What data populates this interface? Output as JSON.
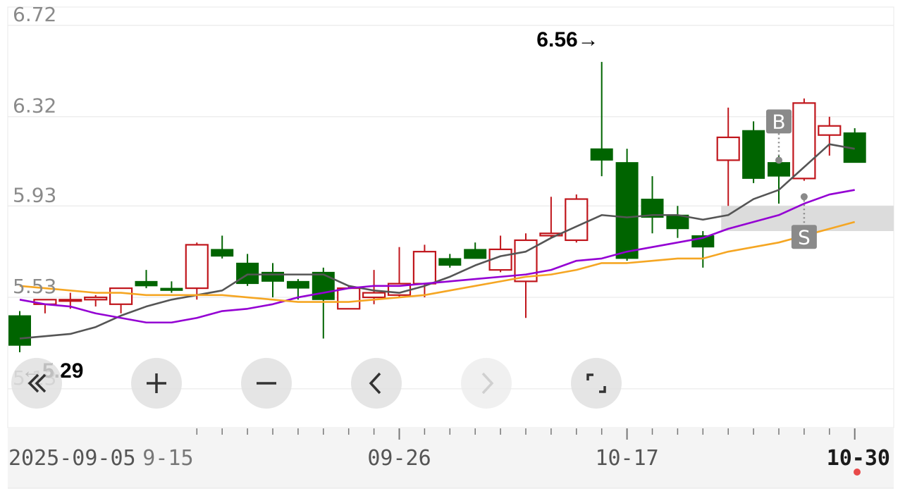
{
  "chart_data": {
    "type": "candlestick",
    "y_ticks": [
      "6.72",
      "6.32",
      "5.93",
      "5.53",
      "5.13"
    ],
    "ylim": [
      5.13,
      6.72
    ],
    "x_ticks": [
      {
        "label": "2025-09-05",
        "index": 0
      },
      {
        "label": "9-15",
        "index": 6
      },
      {
        "label": "09-26",
        "index": 15
      },
      {
        "label": "10-17",
        "index": 24
      },
      {
        "label": "10-30",
        "index": 33
      }
    ],
    "candles": [
      {
        "o": 5.45,
        "h": 5.47,
        "l": 5.29,
        "c": 5.32
      },
      {
        "o": 5.5,
        "h": 5.52,
        "l": 5.46,
        "c": 5.52
      },
      {
        "o": 5.52,
        "h": 5.55,
        "l": 5.48,
        "c": 5.52
      },
      {
        "o": 5.52,
        "h": 5.54,
        "l": 5.49,
        "c": 5.53
      },
      {
        "o": 5.5,
        "h": 5.57,
        "l": 5.46,
        "c": 5.57
      },
      {
        "o": 5.6,
        "h": 5.65,
        "l": 5.57,
        "c": 5.58
      },
      {
        "o": 5.57,
        "h": 5.6,
        "l": 5.55,
        "c": 5.56
      },
      {
        "o": 5.57,
        "h": 5.77,
        "l": 5.52,
        "c": 5.76
      },
      {
        "o": 5.74,
        "h": 5.8,
        "l": 5.7,
        "c": 5.71
      },
      {
        "o": 5.68,
        "h": 5.72,
        "l": 5.58,
        "c": 5.59
      },
      {
        "o": 5.64,
        "h": 5.68,
        "l": 5.53,
        "c": 5.6
      },
      {
        "o": 5.6,
        "h": 5.61,
        "l": 5.52,
        "c": 5.57
      },
      {
        "o": 5.64,
        "h": 5.66,
        "l": 5.35,
        "c": 5.52
      },
      {
        "o": 5.48,
        "h": 5.58,
        "l": 5.48,
        "c": 5.57
      },
      {
        "o": 5.53,
        "h": 5.65,
        "l": 5.5,
        "c": 5.55
      },
      {
        "o": 5.54,
        "h": 5.75,
        "l": 5.53,
        "c": 5.59
      },
      {
        "o": 5.59,
        "h": 5.76,
        "l": 5.53,
        "c": 5.73
      },
      {
        "o": 5.7,
        "h": 5.72,
        "l": 5.66,
        "c": 5.67
      },
      {
        "o": 5.74,
        "h": 5.77,
        "l": 5.71,
        "c": 5.7
      },
      {
        "o": 5.65,
        "h": 5.8,
        "l": 5.64,
        "c": 5.74
      },
      {
        "o": 5.6,
        "h": 5.81,
        "l": 5.44,
        "c": 5.78
      },
      {
        "o": 5.8,
        "h": 5.97,
        "l": 5.79,
        "c": 5.81
      },
      {
        "o": 5.78,
        "h": 5.98,
        "l": 5.77,
        "c": 5.96
      },
      {
        "o": 6.18,
        "h": 6.56,
        "l": 6.06,
        "c": 6.13
      },
      {
        "o": 6.12,
        "h": 6.18,
        "l": 5.69,
        "c": 5.7
      },
      {
        "o": 5.96,
        "h": 6.06,
        "l": 5.81,
        "c": 5.88
      },
      {
        "o": 5.89,
        "h": 5.93,
        "l": 5.79,
        "c": 5.83
      },
      {
        "o": 5.8,
        "h": 5.82,
        "l": 5.66,
        "c": 5.75
      },
      {
        "o": 6.13,
        "h": 6.36,
        "l": 5.93,
        "c": 6.23
      },
      {
        "o": 6.26,
        "h": 6.3,
        "l": 6.03,
        "c": 6.05
      },
      {
        "o": 6.12,
        "h": 6.15,
        "l": 5.94,
        "c": 6.06
      },
      {
        "o": 6.05,
        "h": 6.4,
        "l": 6.04,
        "c": 6.38
      },
      {
        "o": 6.24,
        "h": 6.32,
        "l": 6.15,
        "c": 6.28
      },
      {
        "o": 6.25,
        "h": 6.27,
        "l": 6.12,
        "c": 6.12
      }
    ],
    "ma_series": [
      {
        "color": "#555555",
        "values": [
          5.35,
          5.36,
          5.37,
          5.4,
          5.45,
          5.49,
          5.52,
          5.54,
          5.56,
          5.63,
          5.63,
          5.63,
          5.63,
          5.58,
          5.56,
          5.55,
          5.58,
          5.62,
          5.67,
          5.71,
          5.73,
          5.79,
          5.84,
          5.89,
          5.88,
          5.89,
          5.89,
          5.87,
          5.89,
          5.96,
          6.0,
          6.1,
          6.2,
          6.18
        ]
      },
      {
        "color": "#9400D3",
        "values": [
          5.52,
          5.5,
          5.49,
          5.46,
          5.44,
          5.42,
          5.42,
          5.44,
          5.47,
          5.48,
          5.5,
          5.53,
          5.55,
          5.57,
          5.58,
          5.58,
          5.59,
          5.6,
          5.61,
          5.62,
          5.63,
          5.65,
          5.69,
          5.7,
          5.73,
          5.75,
          5.77,
          5.79,
          5.83,
          5.86,
          5.89,
          5.94,
          5.98,
          6.0
        ]
      },
      {
        "color": "#F5A623",
        "values": [
          5.58,
          5.57,
          5.56,
          5.55,
          5.55,
          5.54,
          5.54,
          5.54,
          5.54,
          5.53,
          5.52,
          5.51,
          5.51,
          5.51,
          5.52,
          5.53,
          5.54,
          5.56,
          5.58,
          5.6,
          5.62,
          5.63,
          5.65,
          5.68,
          5.68,
          5.69,
          5.7,
          5.7,
          5.73,
          5.75,
          5.77,
          5.8,
          5.83,
          5.86
        ]
      }
    ],
    "high_label": "6.56→",
    "low_label": "←5.29",
    "markers": [
      {
        "text": "B",
        "index": 30,
        "price": 6.13,
        "position": "above"
      },
      {
        "text": "S",
        "index": 31,
        "price": 5.97,
        "position": "below"
      }
    ],
    "highlight_band": [
      5.82,
      5.93
    ],
    "up_color": "#C0161C",
    "down_color": "#006400",
    "grid": true
  },
  "controls": [
    {
      "name": "scroll-start-button",
      "icon": "double-chevron-left-icon",
      "enabled": true
    },
    {
      "name": "zoom-in-button",
      "icon": "plus-icon",
      "enabled": true
    },
    {
      "name": "zoom-out-button",
      "icon": "minus-icon",
      "enabled": true
    },
    {
      "name": "scroll-left-button",
      "icon": "chevron-left-icon",
      "enabled": true
    },
    {
      "name": "scroll-right-button",
      "icon": "chevron-right-icon",
      "enabled": false
    },
    {
      "name": "fullscreen-button",
      "icon": "fullscreen-icon",
      "enabled": true
    }
  ]
}
